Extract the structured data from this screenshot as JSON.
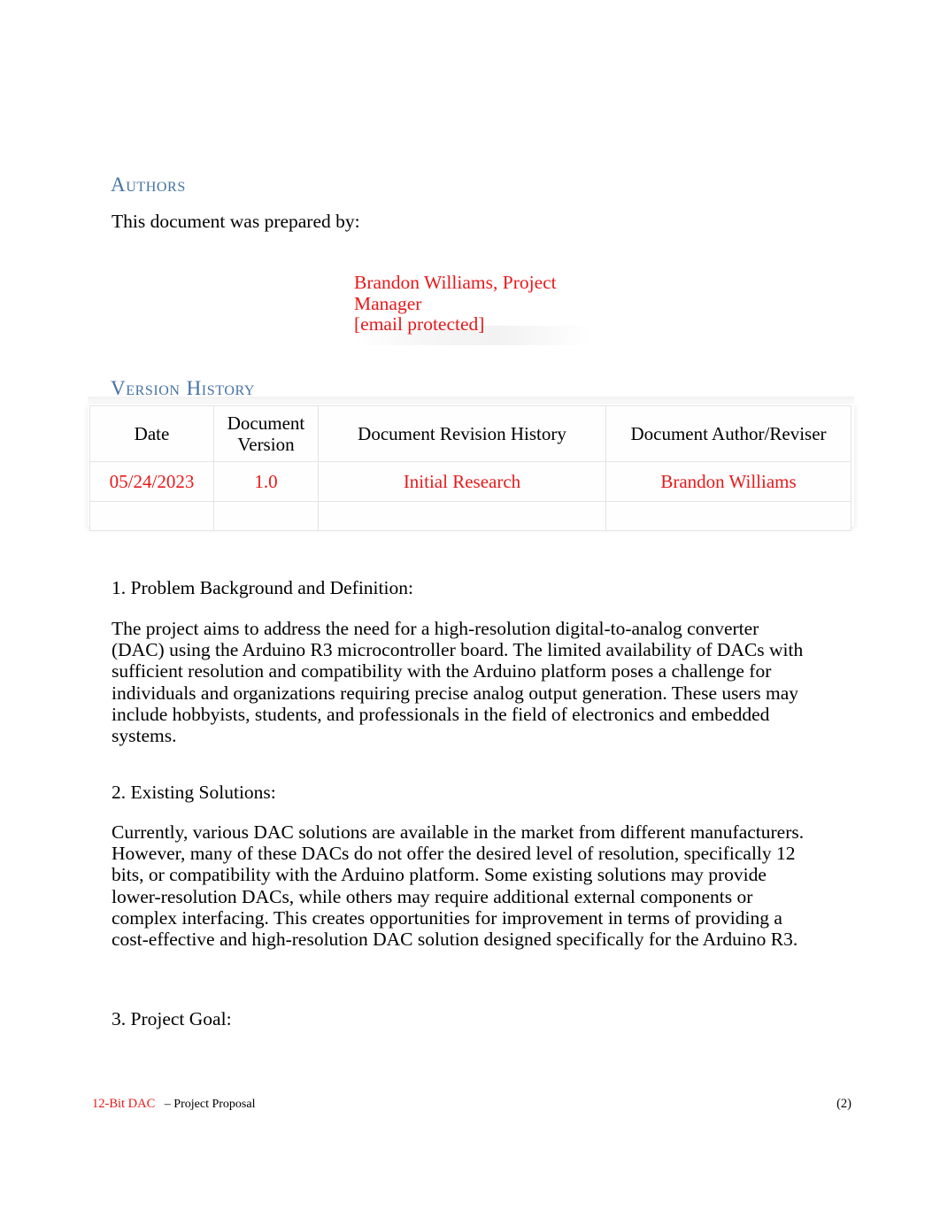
{
  "document": {
    "authors_heading": "Authors",
    "prepared_line": "This document was prepared by:",
    "author": {
      "name_role_line1": "Brandon Williams, Project",
      "name_role_line2": "Manager",
      "email": "[email protected]"
    },
    "version_heading_part1": "Version",
    "version_heading_part2": "History",
    "version_table": {
      "headers": {
        "date": "Date",
        "version_line1": "Document",
        "version_line2": "Version",
        "revision_history": "Document Revision History",
        "author_reviser": "Document Author/Reviser"
      },
      "rows": [
        {
          "date": "05/24/2023",
          "version": "1.0",
          "revision_history": "Initial Research",
          "author_reviser": "Brandon Williams"
        },
        {
          "date": "",
          "version": "",
          "revision_history": "",
          "author_reviser": ""
        }
      ]
    },
    "sections": [
      {
        "heading": "1. Problem Background and Definition:",
        "body": "The project aims to address the need for a high-resolution digital-to-analog converter (DAC) using the Arduino R3 microcontroller board. The limited availability of DACs with sufficient resolution and compatibility with the Arduino platform poses a challenge for individuals and organizations requiring precise analog output generation. These users may include hobbyists, students, and professionals in the field of electronics and embedded systems."
      },
      {
        "heading": "2. Existing Solutions:",
        "body": "Currently, various DAC solutions are available in the market from different manufacturers. However, many of these DACs do not offer the desired level of resolution, specifically 12 bits, or compatibility with the Arduino platform. Some existing solutions may provide lower-resolution DACs, while others may require additional external components or complex interfacing. This creates opportunities for improvement in terms of providing a cost-effective and high-resolution DAC solution designed specifically for the Arduino R3."
      },
      {
        "heading": "3. Project Goal:",
        "body": ""
      }
    ],
    "footer": {
      "title": "12-Bit DAC",
      "subtitle": "– Project Proposal",
      "page_number": "(2)"
    },
    "colors": {
      "heading_blue": "#4472a4",
      "accent_red": "#e8191b",
      "body_black": "#000000",
      "table_border": "#e4e4e4"
    }
  }
}
